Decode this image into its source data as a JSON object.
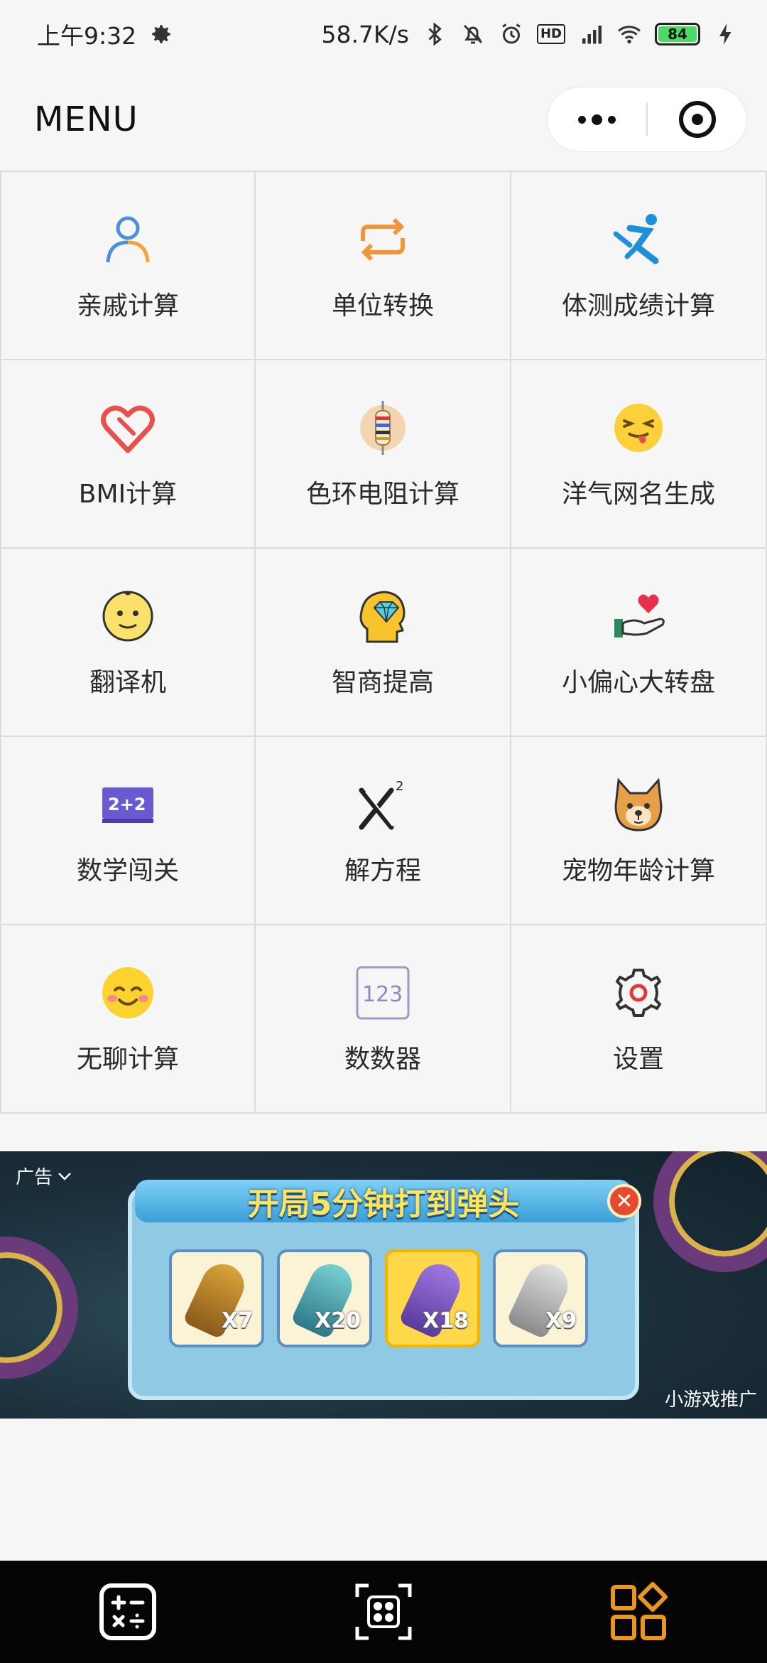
{
  "status_bar": {
    "time": "上午9:32",
    "network_speed": "58.7K/s",
    "network_type": "4G",
    "hd_label": "HD",
    "battery_level": "84"
  },
  "header": {
    "title": "MENU"
  },
  "grid": {
    "items": [
      {
        "label": "亲戚计算",
        "icon": "person-icon"
      },
      {
        "label": "单位转换",
        "icon": "repeat-arrows-icon"
      },
      {
        "label": "体测成绩计算",
        "icon": "runner-icon"
      },
      {
        "label": "BMI计算",
        "icon": "heart-icon"
      },
      {
        "label": "色环电阻计算",
        "icon": "resistor-icon"
      },
      {
        "label": "洋气网名生成",
        "icon": "tongue-emoji-icon"
      },
      {
        "label": "翻译机",
        "icon": "smiley-face-icon"
      },
      {
        "label": "智商提高",
        "icon": "head-diamond-icon"
      },
      {
        "label": "小偏心大转盘",
        "icon": "hand-heart-icon"
      },
      {
        "label": "数学闯关",
        "icon": "chalkboard-icon"
      },
      {
        "label": "解方程",
        "icon": "x-squared-icon"
      },
      {
        "label": "宠物年龄计算",
        "icon": "dog-face-icon"
      },
      {
        "label": "无聊计算",
        "icon": "blush-emoji-icon"
      },
      {
        "label": "数数器",
        "icon": "counter-123-icon"
      },
      {
        "label": "设置",
        "icon": "gear-icon"
      }
    ]
  },
  "ad": {
    "tag": "广告",
    "title": "开局5分钟打到弹头",
    "items": [
      {
        "count": "X7"
      },
      {
        "count": "X20"
      },
      {
        "count": "X18"
      },
      {
        "count": "X9"
      }
    ],
    "source": "小游戏推广"
  },
  "bottom_nav": {
    "items": [
      {
        "icon": "calculator-icon"
      },
      {
        "icon": "scan-grid-icon"
      },
      {
        "icon": "apps-grid-icon",
        "active_color": "#e8961e"
      }
    ]
  }
}
